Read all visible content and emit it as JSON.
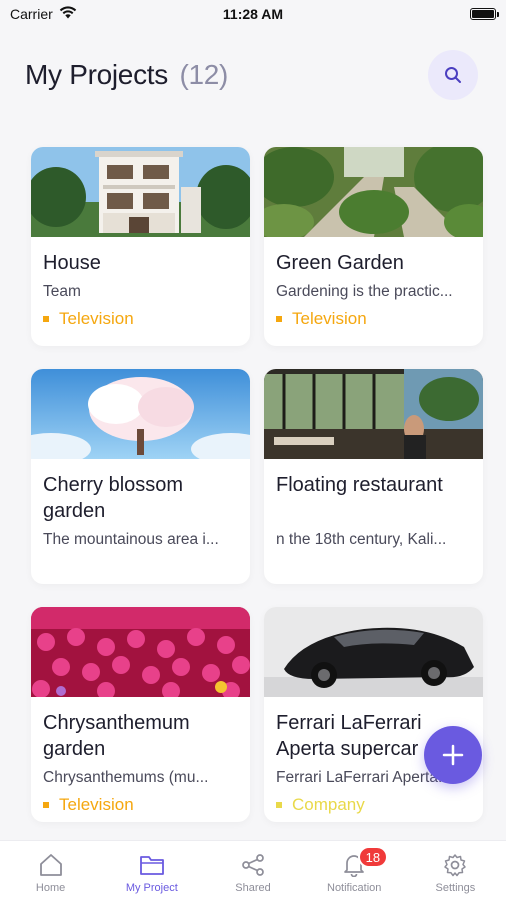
{
  "status_bar": {
    "carrier": "Carrier",
    "time": "11:28 AM",
    "battery_level": 1.0
  },
  "header": {
    "title": "My Projects",
    "count": "(12)",
    "search_icon": "search-icon"
  },
  "projects": [
    {
      "title": "House",
      "description": "Team",
      "tag": "Television",
      "tag_color": "#f5a70f",
      "image": "house"
    },
    {
      "title": "Green Garden",
      "description": "Gardening is the practic...",
      "tag": "Television",
      "tag_color": "#f5a70f",
      "image": "garden"
    },
    {
      "title": "Cherry blossom garden",
      "description": "The mountainous area i...",
      "tag": "",
      "tag_color": "",
      "image": "cherry"
    },
    {
      "title": "Floating restaurant",
      "description": "n the 18th century, Kali...",
      "tag": "",
      "tag_color": "",
      "image": "restaurant"
    },
    {
      "title": "Chrysanthemum garden",
      "description": "Chrysanthemums (mu...",
      "tag": "Television",
      "tag_color": "#f5a70f",
      "image": "chrysanthemum"
    },
    {
      "title": "Ferrari LaFerrari Aperta supercar",
      "description": "Ferrari LaFerrari Aperta...",
      "tag": "Company",
      "tag_color": "#e9d94a",
      "image": "ferrari"
    }
  ],
  "fab": {
    "icon": "plus-icon"
  },
  "accent_color": "#6a5ae0",
  "bottom_nav": {
    "items": [
      {
        "label": "Home",
        "icon": "home-icon"
      },
      {
        "label": "My Project",
        "icon": "folder-icon"
      },
      {
        "label": "Shared",
        "icon": "share-icon"
      },
      {
        "label": "Notification",
        "icon": "bell-icon",
        "badge": "18"
      },
      {
        "label": "Settings",
        "icon": "gear-icon"
      }
    ]
  }
}
